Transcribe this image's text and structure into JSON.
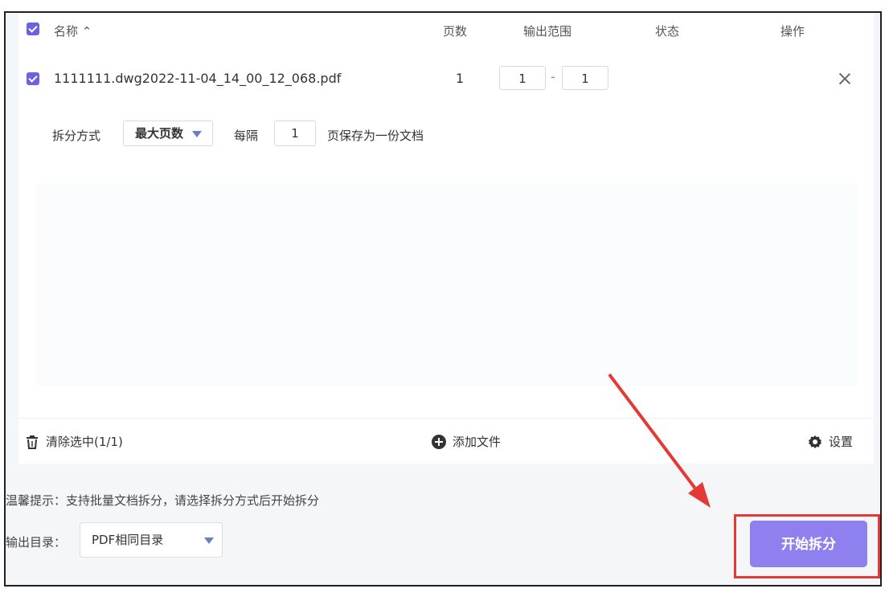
{
  "columns": {
    "name": "名称 ⌃",
    "pages": "页数",
    "range": "输出范围",
    "status": "状态",
    "actions": "操作"
  },
  "file": {
    "name": "1111111.dwg2022-11-04_14_00_12_068.pdf",
    "pages": "1",
    "range_from": "1",
    "range_sep": "-",
    "range_to": "1"
  },
  "split": {
    "label": "拆分方式",
    "mode": "最大页数",
    "every_label": "每隔",
    "every_value": "1",
    "suffix": "页保存为一份文档"
  },
  "toolbar": {
    "clear": "清除选中(1/1)",
    "add": "添加文件",
    "settings": "设置"
  },
  "tip": "温馨提示：支持批量文档拆分，请选择拆分方式后开始拆分",
  "output": {
    "label": "输出目录：",
    "value": "PDF相同目录"
  },
  "start_button": "开始拆分",
  "colors": {
    "accent": "#6b62de",
    "button": "#8f80ef",
    "highlight": "#e53935"
  },
  "icons": [
    "checkbox-icon",
    "close-icon",
    "dropdown-icon",
    "trash-icon",
    "plus-circle-icon",
    "gear-icon",
    "arrow-annotation"
  ]
}
